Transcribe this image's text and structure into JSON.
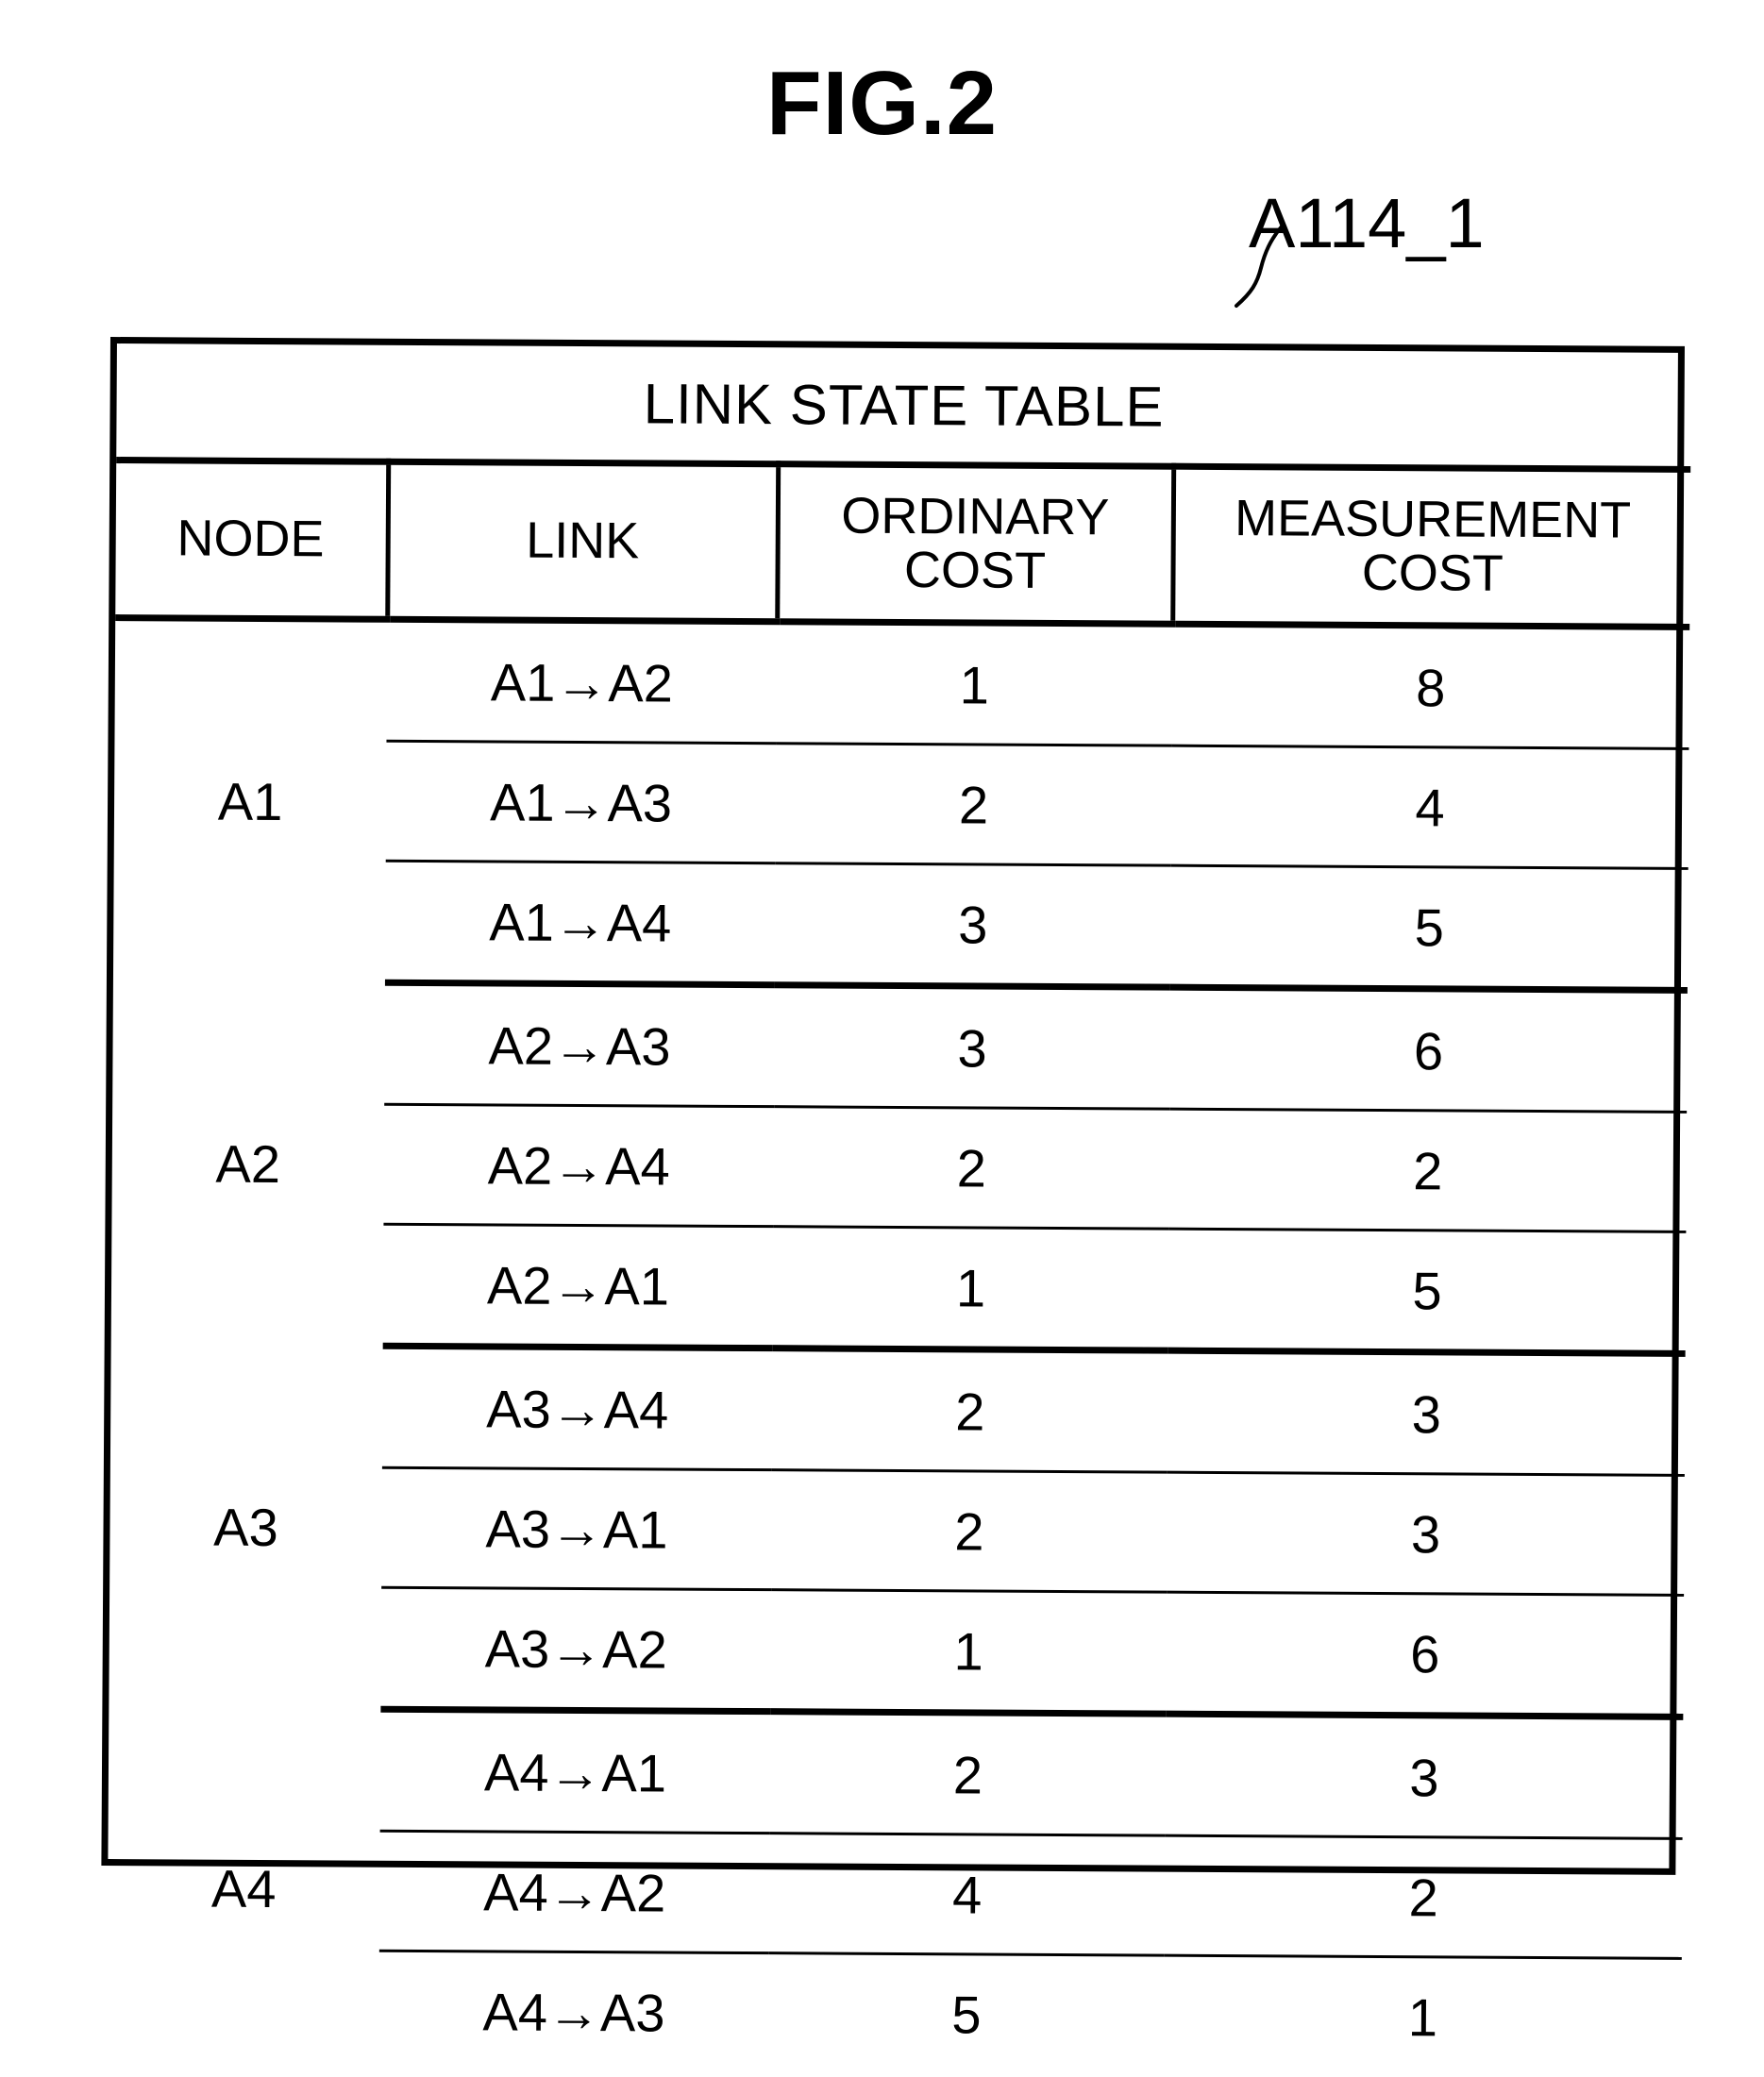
{
  "figure": {
    "title": "FIG.2",
    "reference_label": "A114_1"
  },
  "table": {
    "title": "LINK STATE TABLE",
    "columns": [
      {
        "key": "node",
        "label": "NODE"
      },
      {
        "key": "link",
        "label": "LINK"
      },
      {
        "key": "ordinary_cost",
        "label_line1": "ORDINARY",
        "label_line2": "COST"
      },
      {
        "key": "measurement_cost",
        "label_line1": "MEASUREMENT",
        "label_line2": "COST"
      }
    ],
    "groups": [
      {
        "node": "A1",
        "rows": [
          {
            "link": "A1→A2",
            "ordinary_cost": "1",
            "measurement_cost": "8"
          },
          {
            "link": "A1→A3",
            "ordinary_cost": "2",
            "measurement_cost": "4"
          },
          {
            "link": "A1→A4",
            "ordinary_cost": "3",
            "measurement_cost": "5"
          }
        ]
      },
      {
        "node": "A2",
        "rows": [
          {
            "link": "A2→A3",
            "ordinary_cost": "3",
            "measurement_cost": "6"
          },
          {
            "link": "A2→A4",
            "ordinary_cost": "2",
            "measurement_cost": "2"
          },
          {
            "link": "A2→A1",
            "ordinary_cost": "1",
            "measurement_cost": "5"
          }
        ]
      },
      {
        "node": "A3",
        "rows": [
          {
            "link": "A3→A4",
            "ordinary_cost": "2",
            "measurement_cost": "3"
          },
          {
            "link": "A3→A1",
            "ordinary_cost": "2",
            "measurement_cost": "3"
          },
          {
            "link": "A3→A2",
            "ordinary_cost": "1",
            "measurement_cost": "6"
          }
        ]
      },
      {
        "node": "A4",
        "rows": [
          {
            "link": "A4→A1",
            "ordinary_cost": "2",
            "measurement_cost": "3"
          },
          {
            "link": "A4→A2",
            "ordinary_cost": "4",
            "measurement_cost": "2"
          },
          {
            "link": "A4→A3",
            "ordinary_cost": "5",
            "measurement_cost": "1"
          }
        ]
      }
    ]
  },
  "colors": {
    "ink": "#000000",
    "paper": "#ffffff"
  }
}
